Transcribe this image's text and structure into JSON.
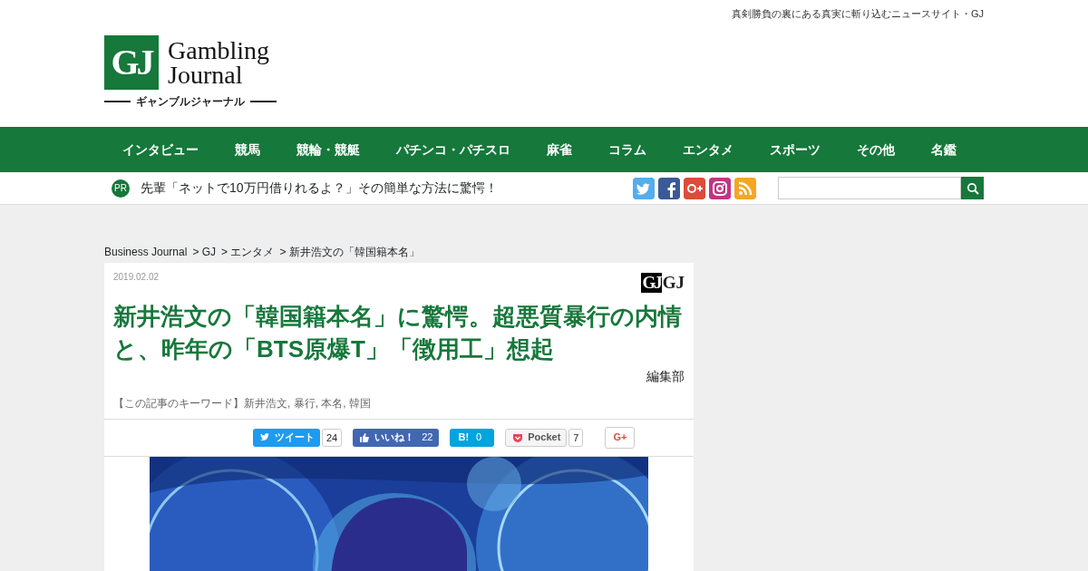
{
  "tagline": "真剣勝負の裏にある真実に斬り込むニュースサイト・GJ",
  "logo": {
    "mark": "GJ",
    "line1": "Gambling",
    "line2": "Journal",
    "subtitle": "ギャンブルジャーナル"
  },
  "nav": [
    {
      "label": "インタビュー"
    },
    {
      "label": "競馬"
    },
    {
      "label": "競輪・競艇"
    },
    {
      "label": "パチンコ・パチスロ"
    },
    {
      "label": "麻雀"
    },
    {
      "label": "コラム"
    },
    {
      "label": "エンタメ"
    },
    {
      "label": "スポーツ"
    },
    {
      "label": "その他"
    },
    {
      "label": "名鑑"
    }
  ],
  "pr": {
    "badge": "PR",
    "text": "先輩「ネットで10万円借りれるよ？」その簡単な方法に驚愕！"
  },
  "social": [
    {
      "kind": "twitter"
    },
    {
      "kind": "facebook"
    },
    {
      "kind": "gplus"
    },
    {
      "kind": "instagram"
    },
    {
      "kind": "rss"
    }
  ],
  "breadcrumb": [
    "Business Journal",
    "> GJ",
    "> エンタメ",
    "> 新井浩文の「韓国籍本名」"
  ],
  "article": {
    "date": "2019.02.02",
    "source_mark": "GJ",
    "source": "GJ",
    "title": "新井浩文の「韓国籍本名」に驚愕。超悪質暴行の内情と、昨年の「BTS原爆T」「徴用工」想起",
    "author": "編集部",
    "keywords": "【この記事のキーワード】新井浩文, 暴行, 本名, 韓国"
  },
  "share": [
    {
      "kind": "twitter",
      "label": "ツイート",
      "count": "24"
    },
    {
      "kind": "facebook",
      "label": "いいね！",
      "count": "22"
    },
    {
      "kind": "hatena",
      "label": "B!",
      "count": "0"
    },
    {
      "kind": "pocket",
      "label": "Pocket",
      "count": "7"
    },
    {
      "kind": "gplus",
      "label": "G+"
    }
  ]
}
